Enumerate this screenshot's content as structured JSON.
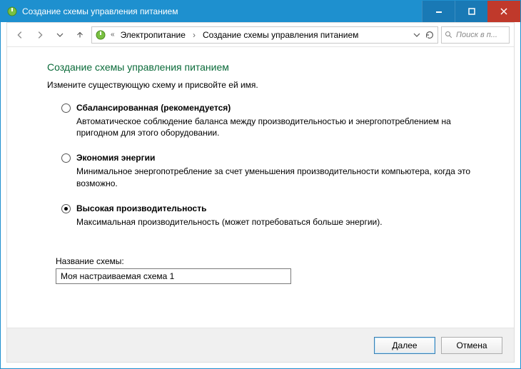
{
  "window": {
    "title": "Создание схемы управления питанием"
  },
  "breadcrumb": {
    "root": "Электропитание",
    "current": "Создание схемы управления питанием"
  },
  "search": {
    "placeholder": "Поиск в п..."
  },
  "page": {
    "heading": "Создание схемы управления питанием",
    "subtext": "Измените существующую схему и присвойте ей имя."
  },
  "options": [
    {
      "label": "Сбалансированная (рекомендуется)",
      "desc": "Автоматическое соблюдение баланса между производительностью и энергопотреблением на пригодном для этого оборудовании.",
      "selected": false
    },
    {
      "label": "Экономия энергии",
      "desc": "Минимальное энергопотребление за счет уменьшения производительности компьютера, когда это возможно.",
      "selected": false
    },
    {
      "label": "Высокая производительность",
      "desc": "Максимальная производительность (может потребоваться больше энергии).",
      "selected": true
    }
  ],
  "plan_name": {
    "label": "Название схемы:",
    "value": "Моя настраиваемая схема 1"
  },
  "buttons": {
    "next": "Далее",
    "cancel": "Отмена"
  }
}
